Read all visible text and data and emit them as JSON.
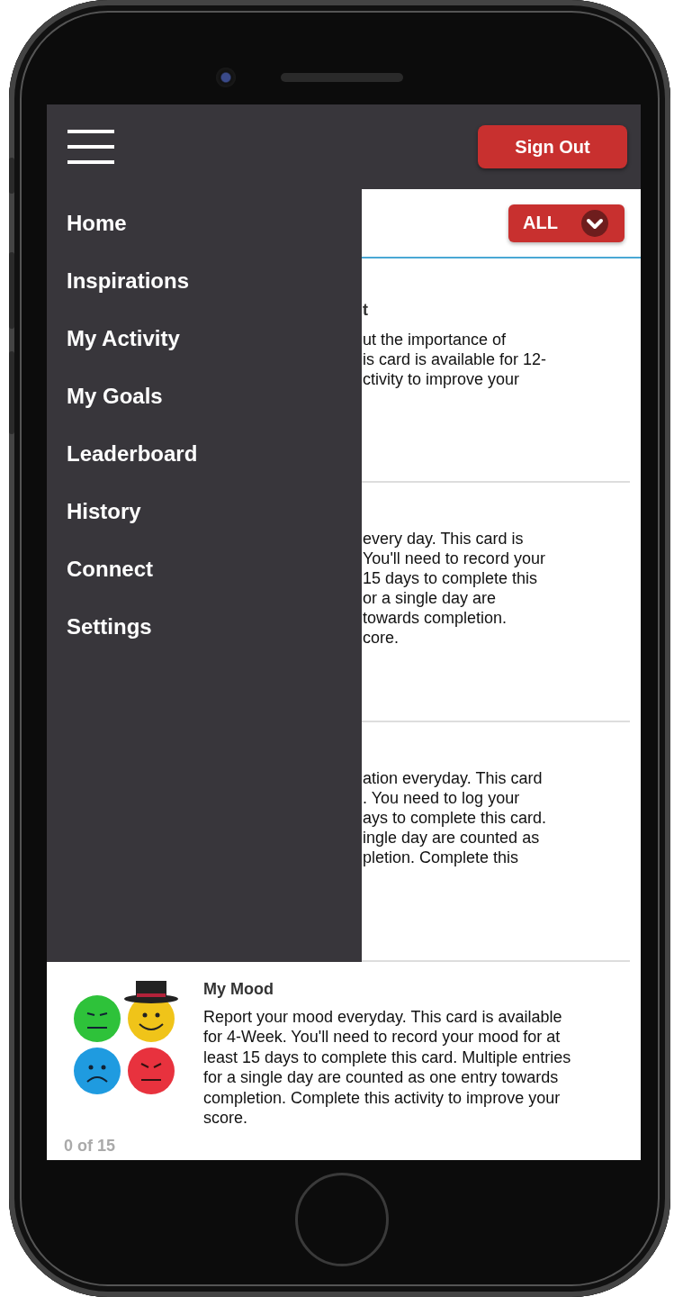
{
  "header": {
    "sign_out": "Sign Out"
  },
  "menu": [
    {
      "label": "Home"
    },
    {
      "label": "Inspirations"
    },
    {
      "label": "My Activity"
    },
    {
      "label": "My Goals"
    },
    {
      "label": "Leaderboard"
    },
    {
      "label": "History"
    },
    {
      "label": "Connect"
    },
    {
      "label": "Settings"
    }
  ],
  "filter": {
    "label": "ALL"
  },
  "partial_cards": [
    {
      "title": "t",
      "lines": [
        "ut the importance of",
        "is card is available for 12-",
        "ctivity to improve your"
      ]
    },
    {
      "lines": [
        "every day. This card is",
        "You'll need to record your",
        "15 days to complete this",
        "or a single day are",
        "towards completion.",
        "core."
      ]
    },
    {
      "lines": [
        "ation everyday. This card",
        ". You need to log your",
        "ays to complete this card.",
        "ingle day are counted as",
        "pletion. Complete this"
      ]
    }
  ],
  "mood_card": {
    "title": "My Mood",
    "description": "Report your mood everyday. This card is available for 4-Week. You'll need to record your mood for at least 15 days to complete this card. Multiple entries for a single day are counted as one entry towards completion. Complete this activity to improve your score.",
    "progress": "0 of 15"
  }
}
